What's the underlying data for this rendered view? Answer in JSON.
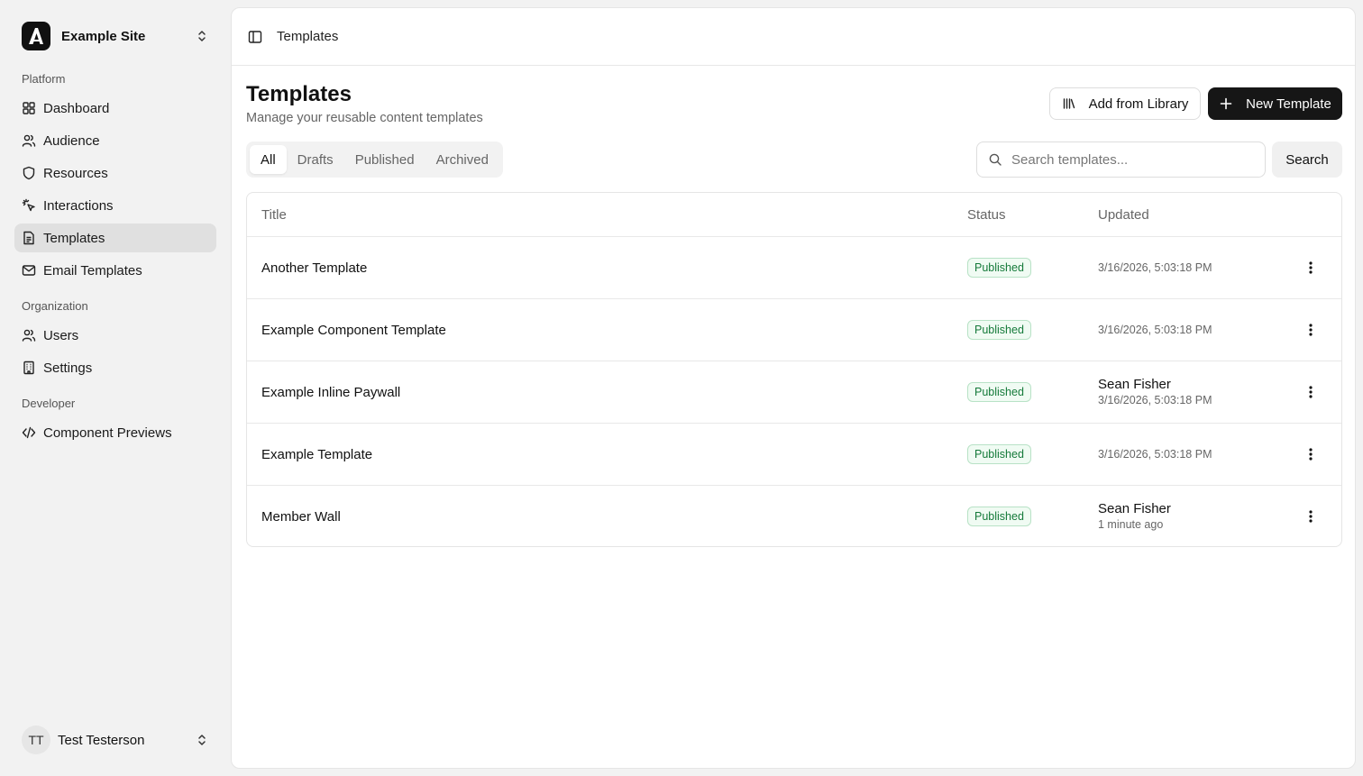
{
  "sidebar": {
    "site_name": "Example Site",
    "sections": {
      "platform": "Platform",
      "organization": "Organization",
      "developer": "Developer"
    },
    "items": {
      "dashboard": "Dashboard",
      "audience": "Audience",
      "resources": "Resources",
      "interactions": "Interactions",
      "templates": "Templates",
      "email_templates": "Email Templates",
      "users": "Users",
      "settings": "Settings",
      "component_previews": "Component Previews"
    },
    "active_item": "templates",
    "user": {
      "initials": "TT",
      "name": "Test Testerson"
    }
  },
  "topbar": {
    "breadcrumb": "Templates"
  },
  "page": {
    "title": "Templates",
    "subtitle": "Manage your reusable content templates",
    "add_from_library_label": "Add from Library",
    "new_template_label": "New Template"
  },
  "tabs": {
    "all": "All",
    "drafts": "Drafts",
    "published": "Published",
    "archived": "Archived",
    "active": "all"
  },
  "search": {
    "placeholder": "Search templates...",
    "value": "",
    "button_label": "Search"
  },
  "table": {
    "columns": {
      "title": "Title",
      "status": "Status",
      "updated": "Updated"
    },
    "rows": [
      {
        "title": "Another Template",
        "status": "Published",
        "updated_by": "",
        "updated_at": "3/16/2026, 5:03:18 PM"
      },
      {
        "title": "Example Component Template",
        "status": "Published",
        "updated_by": "",
        "updated_at": "3/16/2026, 5:03:18 PM"
      },
      {
        "title": "Example Inline Paywall",
        "status": "Published",
        "updated_by": "Sean Fisher",
        "updated_at": "3/16/2026, 5:03:18 PM"
      },
      {
        "title": "Example Template",
        "status": "Published",
        "updated_by": "",
        "updated_at": "3/16/2026, 5:03:18 PM"
      },
      {
        "title": "Member Wall",
        "status": "Published",
        "updated_by": "Sean Fisher",
        "updated_at": "1 minute ago"
      }
    ]
  },
  "colors": {
    "published_badge_text": "#157a3a",
    "published_badge_bg": "#f0fbf3",
    "primary_button": "#161616",
    "active_nav_bg": "#e0e0e0"
  }
}
